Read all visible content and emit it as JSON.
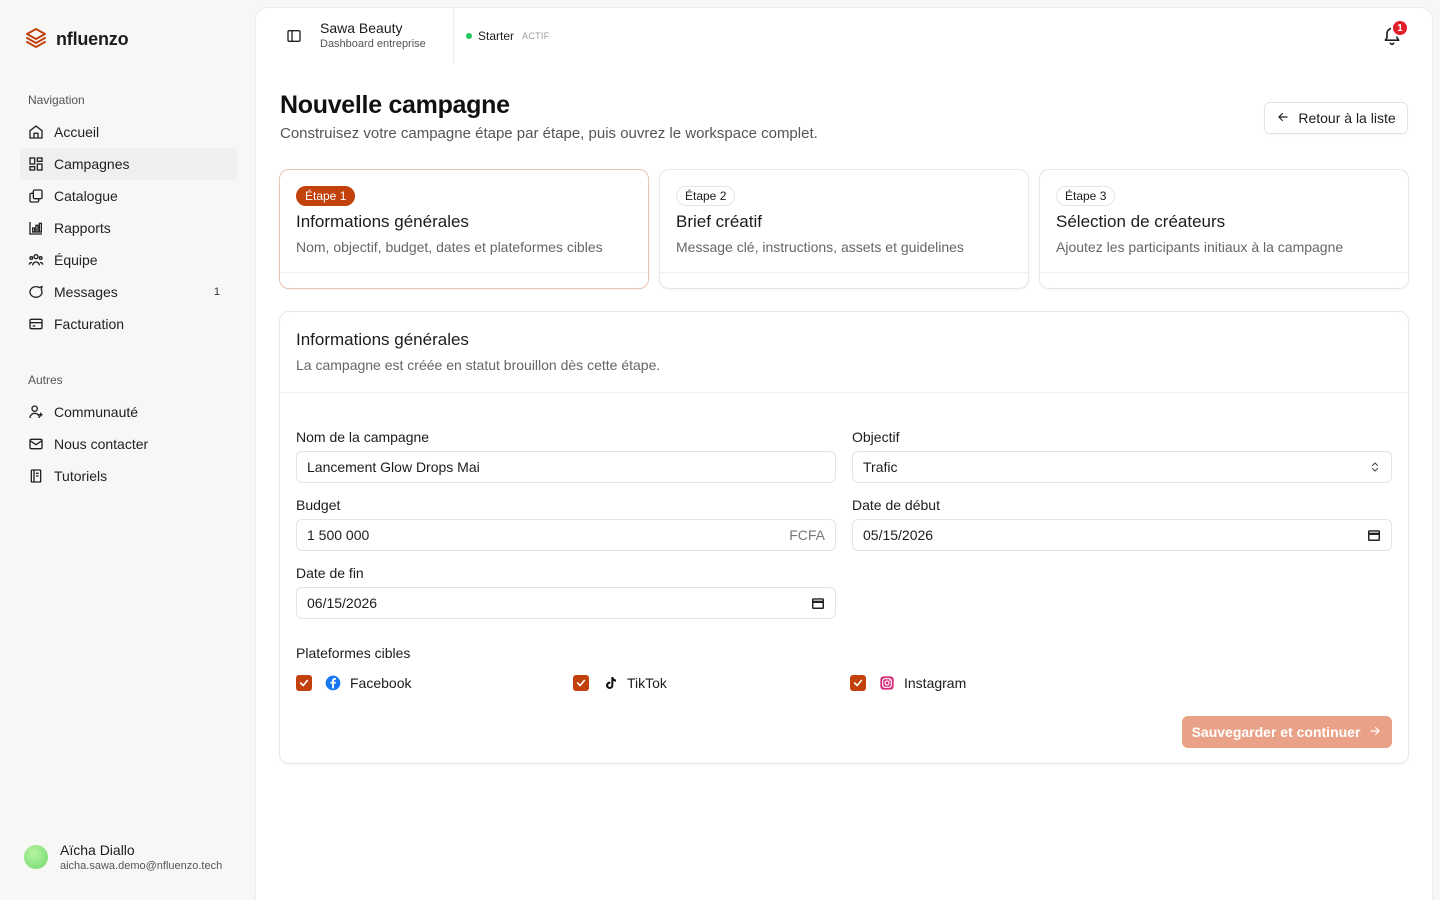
{
  "brand": {
    "name": "nfluenzo",
    "accent": "#c2410c"
  },
  "sidebar": {
    "nav_heading": "Navigation",
    "items": [
      {
        "label": "Accueil",
        "icon": "home-icon"
      },
      {
        "label": "Campagnes",
        "icon": "campaigns-icon",
        "active": true
      },
      {
        "label": "Catalogue",
        "icon": "catalog-icon"
      },
      {
        "label": "Rapports",
        "icon": "chart-icon"
      },
      {
        "label": "Équipe",
        "icon": "team-icon"
      },
      {
        "label": "Messages",
        "icon": "message-icon",
        "count": "1"
      },
      {
        "label": "Facturation",
        "icon": "billing-icon"
      }
    ],
    "other_heading": "Autres",
    "other_items": [
      {
        "label": "Communauté",
        "icon": "community-icon"
      },
      {
        "label": "Nous contacter",
        "icon": "mail-icon"
      },
      {
        "label": "Tutoriels",
        "icon": "book-icon"
      }
    ],
    "user": {
      "name": "Aïcha Diallo",
      "email": "aicha.sawa.demo@nfluenzo.tech"
    }
  },
  "topbar": {
    "org_name": "Sawa Beauty",
    "org_sub": "Dashboard entreprise",
    "plan_name": "Starter",
    "plan_status": "ACTIF",
    "notification_count": "1"
  },
  "page": {
    "title": "Nouvelle campagne",
    "subtitle": "Construisez votre campagne étape par étape, puis ouvrez le workspace complet.",
    "back_label": "Retour à la liste"
  },
  "steps": [
    {
      "badge": "Étape 1",
      "title": "Informations générales",
      "desc": "Nom, objectif, budget, dates et plateformes cibles",
      "active": true
    },
    {
      "badge": "Étape 2",
      "title": "Brief créatif",
      "desc": "Message clé, instructions, assets et guidelines"
    },
    {
      "badge": "Étape 3",
      "title": "Sélection de créateurs",
      "desc": "Ajoutez les participants initiaux à la campagne"
    }
  ],
  "form": {
    "title": "Informations générales",
    "subtitle": "La campagne est créée en statut brouillon dès cette étape.",
    "name_label": "Nom de la campagne",
    "name_value": "Lancement Glow Drops Mai",
    "objective_label": "Objectif",
    "objective_value": "Trafic",
    "budget_label": "Budget",
    "budget_value": "1 500 000",
    "budget_currency": "FCFA",
    "start_label": "Date de début",
    "start_value": "05/15/2026",
    "end_label": "Date de fin",
    "end_value": "06/15/2026",
    "platforms_label": "Plateformes cibles",
    "platforms": [
      {
        "label": "Facebook",
        "icon": "facebook-icon",
        "checked": true
      },
      {
        "label": "TikTok",
        "icon": "tiktok-icon",
        "checked": true
      },
      {
        "label": "Instagram",
        "icon": "instagram-icon",
        "checked": true
      }
    ],
    "submit_label": "Sauvegarder et continuer"
  }
}
